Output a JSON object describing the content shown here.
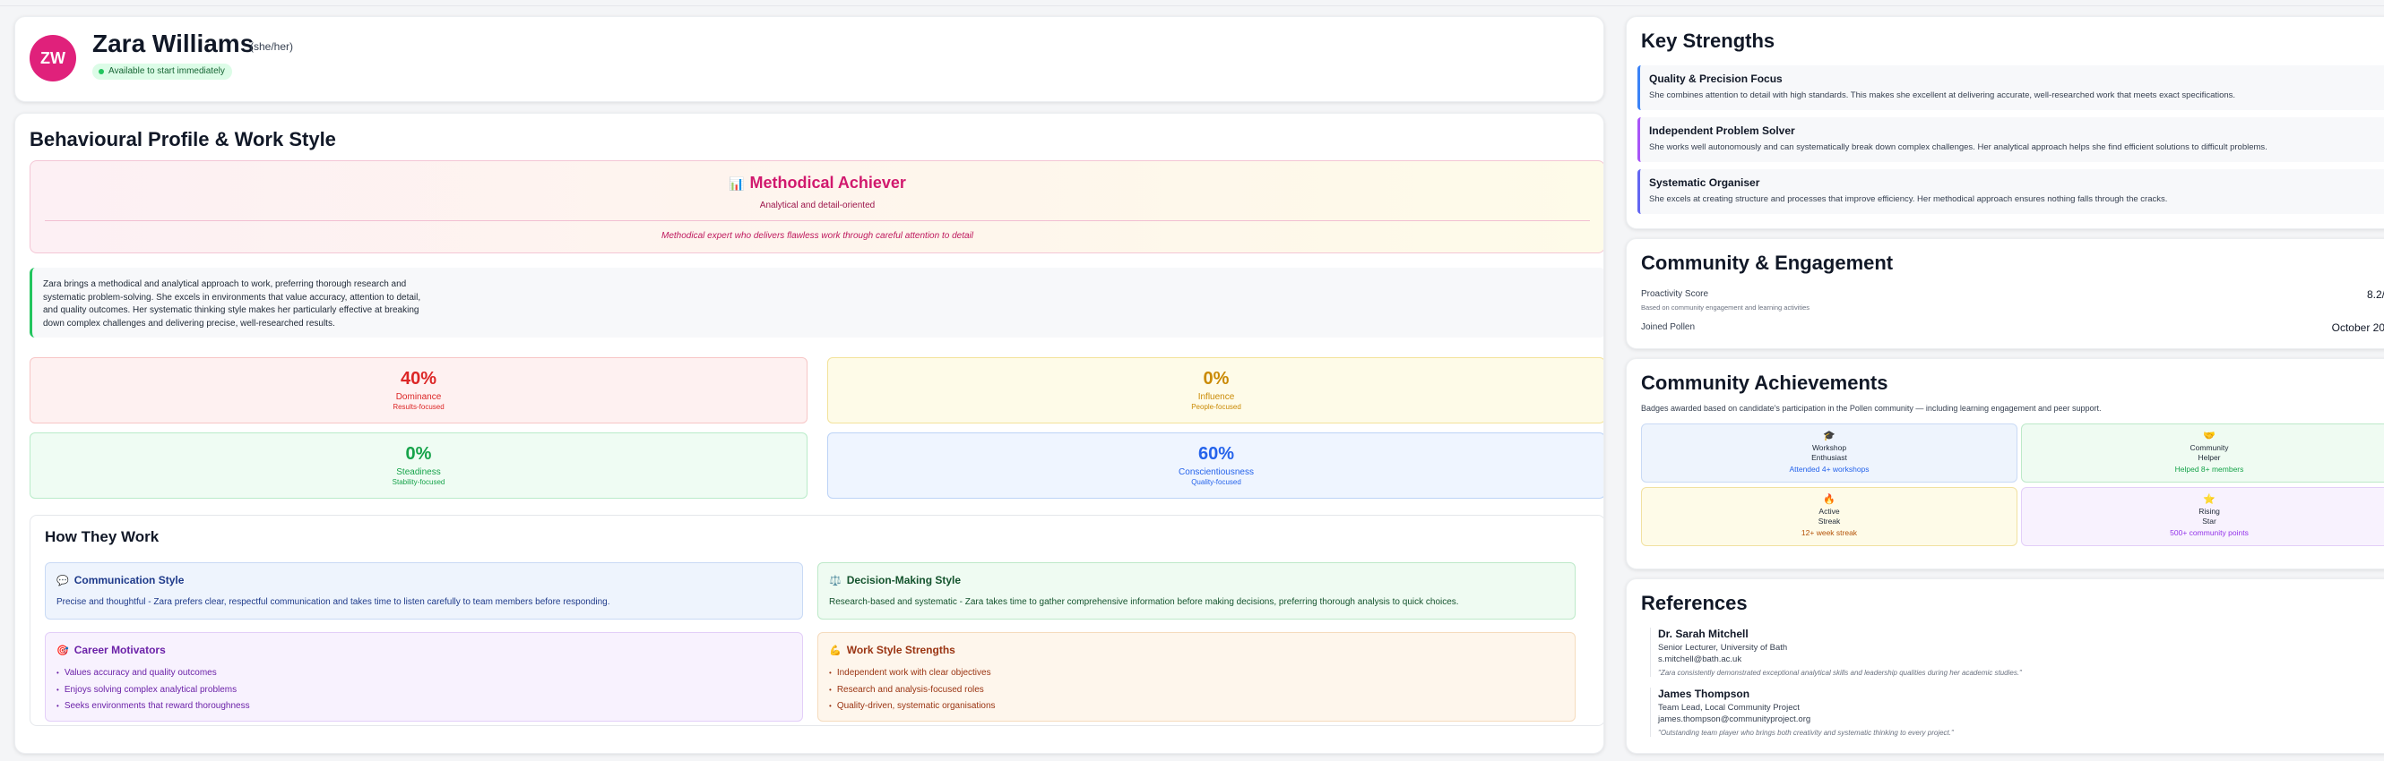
{
  "profile": {
    "initials": "ZW",
    "name": "Zara Williams",
    "pronouns": "(she/her)",
    "availability": "Available to start immediately"
  },
  "behaviour": {
    "section_title": "Behavioural Profile & Work Style",
    "archetype": {
      "icon": "📊",
      "title": "Methodical Achiever",
      "subtitle": "Analytical and detail-oriented",
      "quote": "Methodical expert who delivers flawless work through careful attention to detail"
    },
    "summary": "Zara brings a methodical and analytical approach to work, preferring thorough research and systematic problem-solving. She excels in environments that value accuracy, attention to detail, and quality outcomes. Her systematic thinking style makes her particularly effective at breaking down complex challenges and delivering precise, well-researched results.",
    "disc": [
      {
        "pct": "40%",
        "name": "Dominance",
        "sub": "Results-focused",
        "color": "#dc2626",
        "bg": "#fef1f1",
        "border": "#f7c6c6"
      },
      {
        "pct": "0%",
        "name": "Influence",
        "sub": "People-focused",
        "color": "#ca8a04",
        "bg": "#fefbe8",
        "border": "#f3e29a"
      },
      {
        "pct": "0%",
        "name": "Steadiness",
        "sub": "Stability-focused",
        "color": "#16a34a",
        "bg": "#effcf3",
        "border": "#b9ebc9"
      },
      {
        "pct": "60%",
        "name": "Conscientiousness",
        "sub": "Quality-focused",
        "color": "#2563eb",
        "bg": "#eff5ff",
        "border": "#bcd3f6"
      }
    ]
  },
  "how_they_work": {
    "title": "How They Work",
    "communication": {
      "icon": "💬",
      "title": "Communication Style",
      "text": "Precise and thoughtful - Zara prefers clear, respectful communication and takes time to listen carefully to team members before responding."
    },
    "decision": {
      "icon": "⚖️",
      "title": "Decision-Making Style",
      "text": "Research-based and systematic - Zara takes time to gather comprehensive information before making decisions, preferring thorough analysis to quick choices."
    },
    "motivators": {
      "icon": "🎯",
      "title": "Career Motivators",
      "items": [
        "Values accuracy and quality outcomes",
        "Enjoys solving complex analytical problems",
        "Seeks environments that reward thoroughness"
      ]
    },
    "strengths": {
      "icon": "💪",
      "title": "Work Style Strengths",
      "items": [
        "Independent work with clear objectives",
        "Research and analysis-focused roles",
        "Quality-driven, systematic organisations"
      ]
    }
  },
  "key_strengths": {
    "title": "Key Strengths",
    "items": [
      {
        "title": "Quality & Precision Focus",
        "text": "She combines attention to detail with high standards. This makes she excellent at delivering accurate, well-researched work that meets exact specifications.",
        "color": "#3b82f6"
      },
      {
        "title": "Independent Problem Solver",
        "text": "She works well autonomously and can systematically break down complex challenges. Her analytical approach helps she find efficient solutions to difficult problems.",
        "color": "#a855f7"
      },
      {
        "title": "Systematic Organiser",
        "text": "She excels at creating structure and processes that improve efficiency. Her methodical approach ensures nothing falls through the cracks.",
        "color": "#6366f1"
      }
    ]
  },
  "community": {
    "title": "Community & Engagement",
    "proactivity_label": "Proactivity Score",
    "proactivity_value": "8.2/",
    "proactivity_note": "Based on community engagement and learning activities",
    "joined_label": "Joined Pollen",
    "joined_value": "October 20"
  },
  "achievements": {
    "title": "Community Achievements",
    "description": "Badges awarded based on candidate's participation in the Pollen community — including learning engagement and peer support.",
    "badges": [
      {
        "icon": "🎓",
        "line1": "Workshop",
        "line2": "Enthusiast",
        "sub": "Attended 4+ workshops",
        "bg": "#eef4fd",
        "border": "#c9daf5",
        "color": "#2563eb"
      },
      {
        "icon": "🤝",
        "line1": "Community",
        "line2": "Helper",
        "sub": "Helped 8+ members",
        "bg": "#effbf2",
        "border": "#bde9c9",
        "color": "#16a34a"
      },
      {
        "icon": "🔥",
        "line1": "Active",
        "line2": "Streak",
        "sub": "12+ week streak",
        "bg": "#fefbe8",
        "border": "#f1e1a1",
        "color": "#b45309"
      },
      {
        "icon": "⭐",
        "line1": "Rising",
        "line2": "Star",
        "sub": "500+ community points",
        "bg": "#f8f2fe",
        "border": "#e3cff8",
        "color": "#9333ea"
      }
    ]
  },
  "references": {
    "title": "References",
    "items": [
      {
        "name": "Dr. Sarah Mitchell",
        "role": "Senior Lecturer, University of Bath",
        "email": "s.mitchell@bath.ac.uk",
        "quote": "\"Zara consistently demonstrated exceptional analytical skills and leadership qualities during her academic studies.\""
      },
      {
        "name": "James Thompson",
        "role": "Team Lead, Local Community Project",
        "email": "james.thompson@communityproject.org",
        "quote": "\"Outstanding team player who brings both creativity and systematic thinking to every project.\""
      }
    ]
  }
}
